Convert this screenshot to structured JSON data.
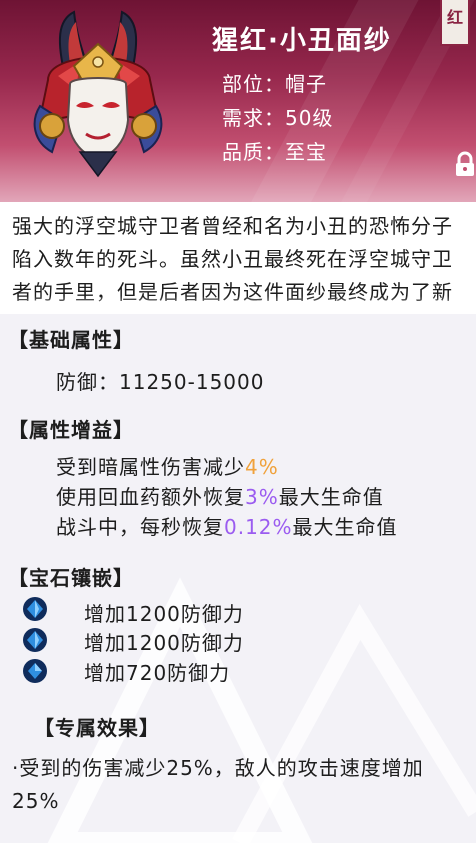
{
  "item": {
    "name": "猩红·小丑面纱",
    "rarity_tag": "红",
    "slot_label": "部位：帽子",
    "requirement_label": "需求：50级",
    "quality_label": "品质：至宝"
  },
  "description": "强大的浮空城守卫者曾经和名为小丑的恐怖分子陷入数年的死斗。虽然小丑最终死在浮空城守卫者的手里，但是后者因为这件面纱最终成为了新一代小丑。",
  "base_attributes": {
    "title": "【基础属性】",
    "defense": "防御：11250-15000"
  },
  "attribute_bonuses": {
    "title": "【属性增益】",
    "lines": [
      {
        "prefix": "受到暗属性伤害减少",
        "value": "4%",
        "suffix": ""
      },
      {
        "prefix": "使用回血药额外恢复",
        "value": "3%",
        "suffix": "最大生命值"
      },
      {
        "prefix": "战斗中，每秒恢复",
        "value": "0.12%",
        "suffix": "最大生命值"
      }
    ]
  },
  "gem_sockets": {
    "title": "【宝石镶嵌】",
    "gems": [
      {
        "icon": "blue-gem-icon",
        "text": "增加1200防御力"
      },
      {
        "icon": "blue-gem-icon",
        "text": "增加1200防御力"
      },
      {
        "icon": "blue-gem-icon",
        "text": "增加720防御力"
      }
    ]
  },
  "exclusive_effect": {
    "title": "【专属效果】",
    "text": "·受到的伤害减少25%，敌人的攻击速度增加25%"
  },
  "colors": {
    "header_dark": "#6e1334",
    "header_light": "#e2a6b9",
    "highlight_orange": "#f0a23c",
    "highlight_purple": "#9b5cf0",
    "gem_blue": "#2f8fe0"
  }
}
